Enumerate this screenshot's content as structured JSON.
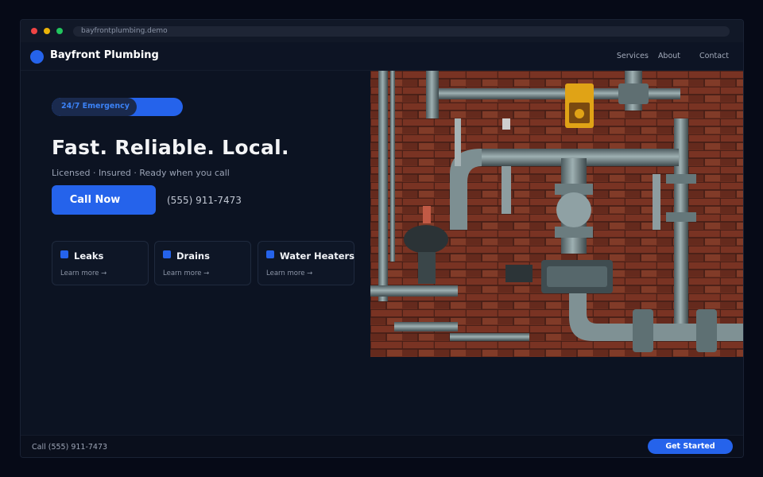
{
  "browser": {
    "url": "bayfrontplumbing.demo"
  },
  "header": {
    "brand": "Bayfront Plumbing",
    "nav": [
      {
        "label": "Services"
      },
      {
        "label": "About"
      },
      {
        "label": "Contact"
      }
    ]
  },
  "hero": {
    "badge": "24/7 Emergency",
    "headline": "Fast. Reliable. Local.",
    "tagline": "Licensed · Insured · Ready when you call",
    "cta_label": "Call Now",
    "phone": "(555) 911-7473"
  },
  "services": [
    {
      "title": "Leaks",
      "link": "Learn more →"
    },
    {
      "title": "Drains",
      "link": "Learn more →"
    },
    {
      "title": "Water Heaters",
      "link": "Learn more →"
    }
  ],
  "footer": {
    "text": "Call (555) 911-7473",
    "cta_label": "Get Started"
  },
  "colors": {
    "accent": "#2563eb",
    "background": "#0c1322",
    "page": "#060a17"
  }
}
